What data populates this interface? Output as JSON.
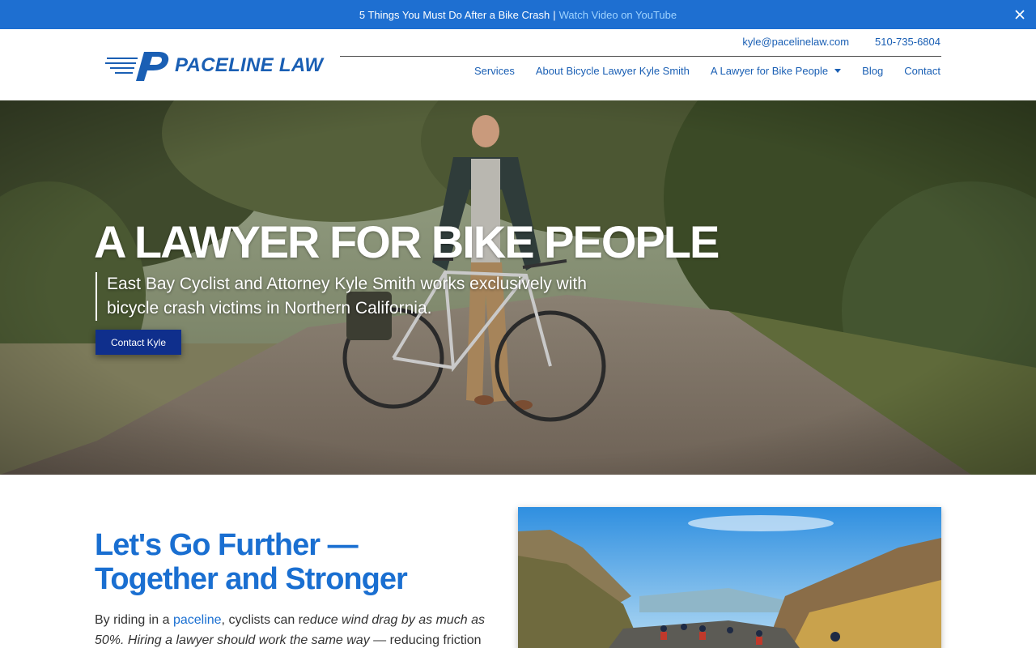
{
  "colors": {
    "announce_bg": "#1e6fd1",
    "brand_blue": "#1a5fb4",
    "button_bg": "#0f2f8c",
    "heading_blue": "#1a6fd1"
  },
  "announcement": {
    "text": "5 Things You Must Do After a Bike Crash",
    "separator": "|",
    "link": "Watch Video on YouTube",
    "close_icon": "close-icon"
  },
  "header": {
    "logo_text": "PACELINE LAW",
    "email": "kyle@pacelinelaw.com",
    "phone": "510-735-6804",
    "nav": [
      {
        "label": "Services"
      },
      {
        "label": "About Bicycle Lawyer Kyle Smith"
      },
      {
        "label": "A Lawyer for Bike People",
        "icon": "chevron-down-icon"
      },
      {
        "label": "Blog"
      },
      {
        "label": "Contact"
      }
    ]
  },
  "hero": {
    "title": "A LAWYER FOR BIKE PEOPLE",
    "subtitle": "East Bay Cyclist and Attorney Kyle Smith works exclusively with bicycle crash victims in Northern California.",
    "button": "Contact Kyle"
  },
  "intro": {
    "title_line1": "Let's Go Further —",
    "title_line2": "Together and Stronger",
    "text_prefix": "By riding in a ",
    "text_link": "paceline",
    "text_mid": ", cyclists can r",
    "text_italic": "educe wind drag by as much as 50%. Hiring a lawyer should work the same way",
    "text_suffix": " — reducing friction"
  }
}
